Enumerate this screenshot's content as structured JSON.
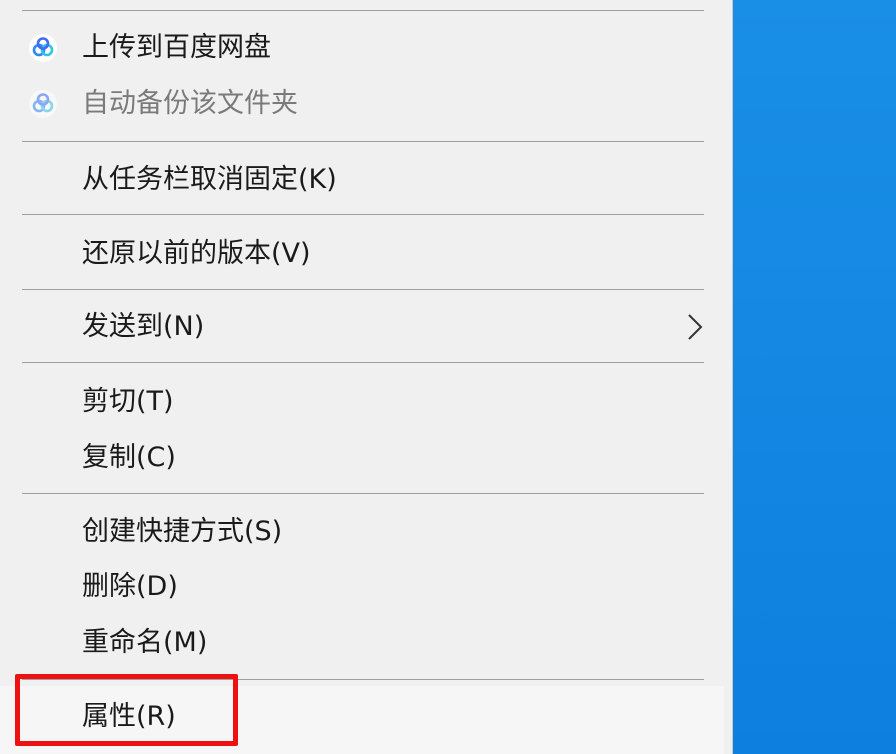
{
  "menu": {
    "baidu_items": [
      {
        "label": "上传到百度网盘",
        "icon": "baidu-netdisk-icon",
        "enabled": true
      },
      {
        "label": "自动备份该文件夹",
        "icon": "baidu-netdisk-icon",
        "enabled": false
      }
    ],
    "unpin": "从任务栏取消固定(K)",
    "restore": "还原以前的版本(V)",
    "send_to": "发送到(N)",
    "cut": "剪切(T)",
    "copy": "复制(C)",
    "create_shortcut": "创建快捷方式(S)",
    "delete": "删除(D)",
    "rename": "重命名(M)",
    "properties": "属性(R)"
  },
  "colors": {
    "menu_bg": "#f0f0f0",
    "desktop_blue": "#0d7fdf",
    "highlight_red": "#ee1111"
  }
}
